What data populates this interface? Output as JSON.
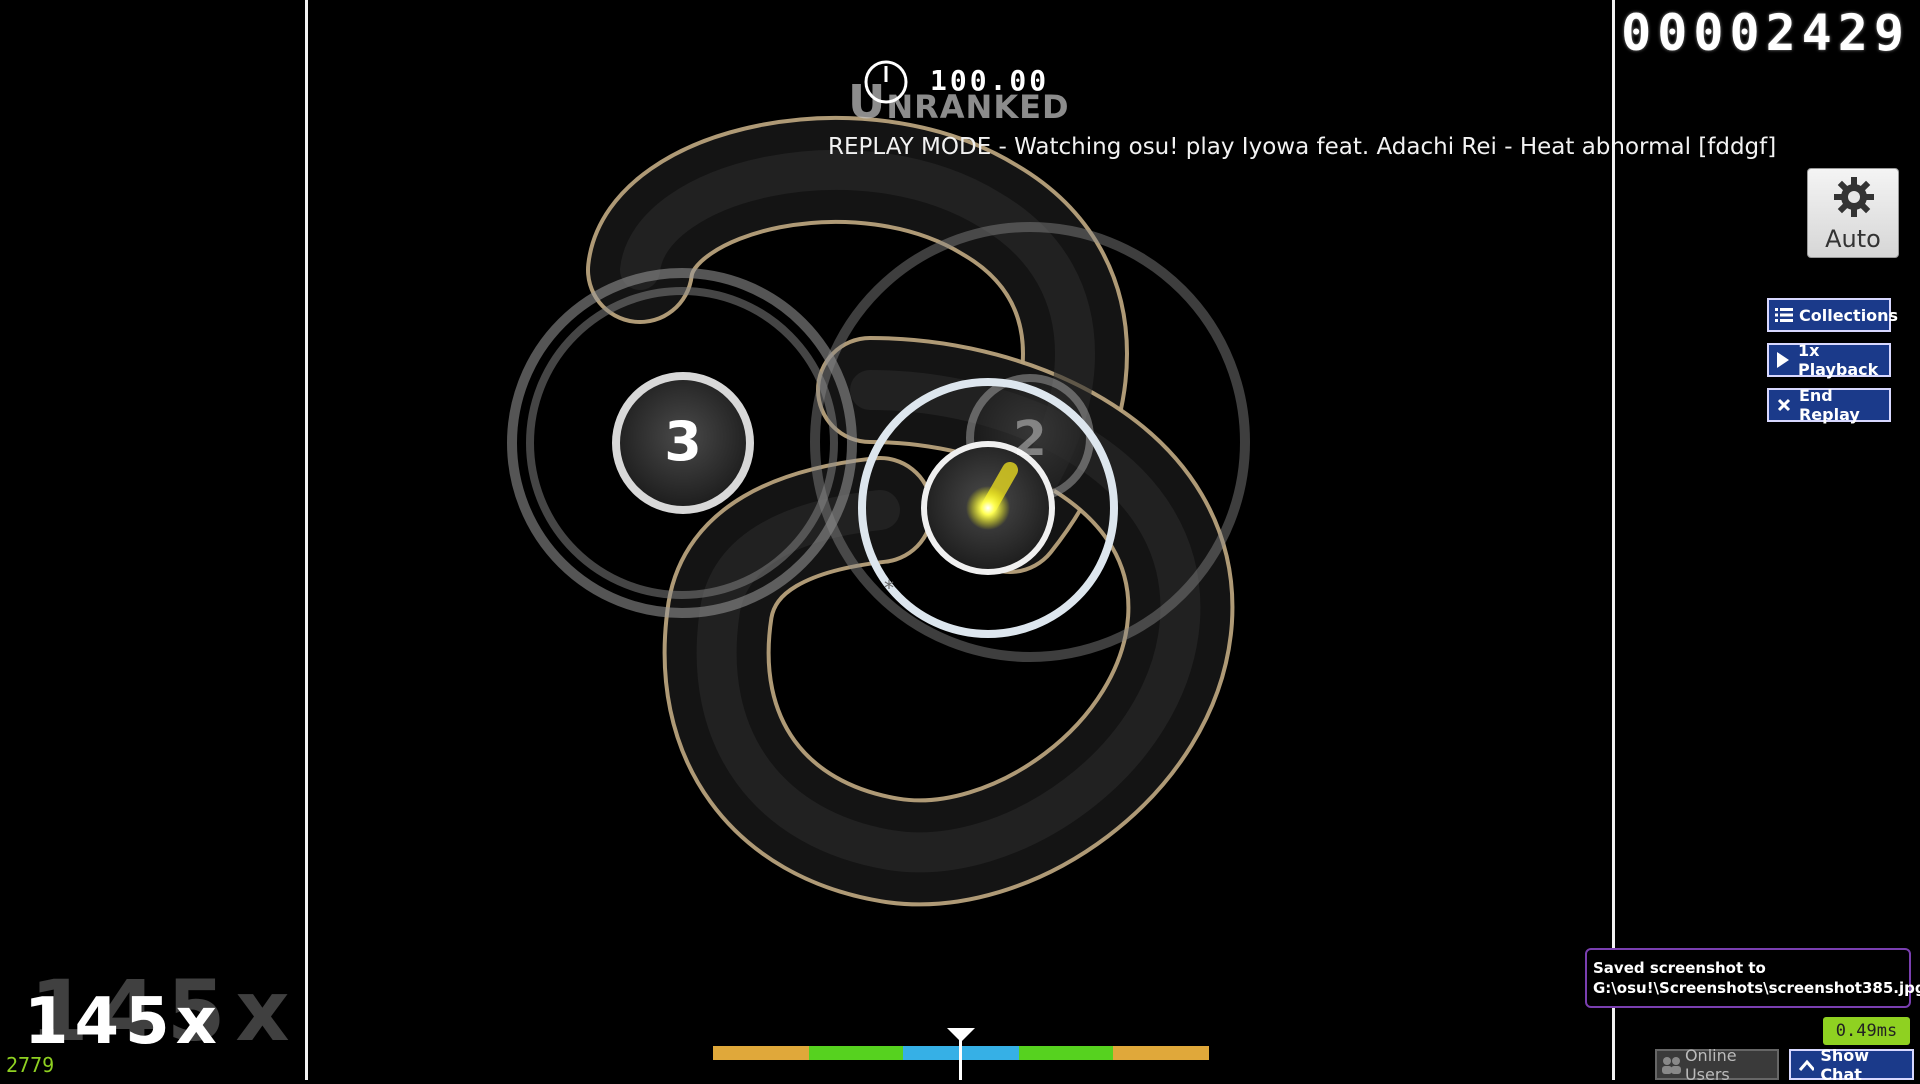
{
  "hud": {
    "score": "00002429",
    "accuracy": "100.00",
    "ranked_status": "Unranked",
    "replay_status": "REPLAY MODE - Watching osu! play Iyowa feat. Adachi Rei - Heat abnormal [fddgf]",
    "combo": "145x",
    "combo_ghost": "145x",
    "frame_counter": "2779"
  },
  "hit_objects": {
    "circle_3_number": "3",
    "circle_2_number": "2"
  },
  "controls": {
    "auto_label": "Auto",
    "collections_label": "Collections",
    "playback_label": "1x Playback",
    "end_replay_label": "End Replay"
  },
  "notifications": {
    "screenshot_message": "Saved screenshot to G:\\osu!\\Screenshots\\screenshot385.jpg",
    "latency": "0.49ms"
  },
  "footer": {
    "online_users_label": "Online Users",
    "show_chat_label": "Show Chat"
  },
  "colors": {
    "slider_border": "#b8a27c",
    "hit_error_50": "#e0a83a",
    "hit_error_100": "#56d21f",
    "hit_error_300": "#36b0e6",
    "button_blue": "#1b3a8a",
    "toast_border": "#7a3fb0",
    "latency_green": "#8fd121",
    "cursor_yellow": "#ffff33"
  }
}
